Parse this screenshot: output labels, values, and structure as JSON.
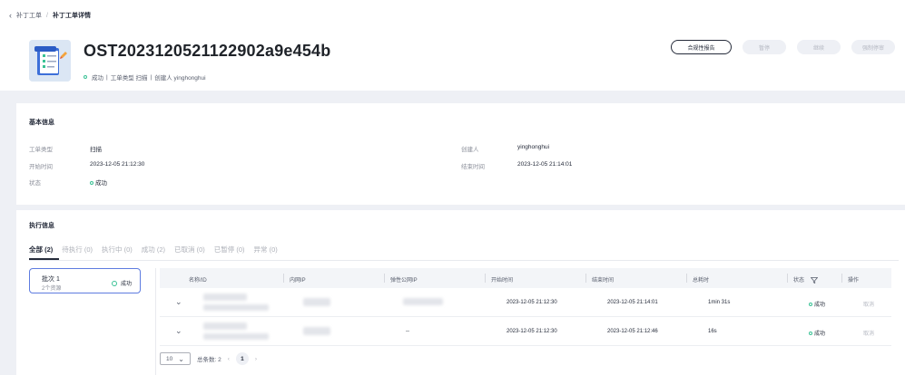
{
  "breadcrumb": {
    "back_icon": "‹",
    "parent": "补丁工单",
    "sep": "/",
    "current": "补丁工单详情"
  },
  "header": {
    "title": "OST2023120521122902a9e454b",
    "meta": {
      "status": "成功",
      "sep1": "|",
      "type": "工单类型 扫描",
      "sep2": "|",
      "creator": "创建人 yinghonghui"
    },
    "actions": {
      "compliance_report": "合规性报告",
      "pause": "暂停",
      "resume": "继续",
      "force_stop": "强制停审"
    }
  },
  "basic_info": {
    "title": "基本信息",
    "type_label": "工单类型",
    "type_value": "扫描",
    "start_label": "开始时间",
    "start_value": "2023-12-05 21:12:30",
    "status_label": "状态",
    "status_value": "成功",
    "creator_label": "创建人",
    "creator_value": "yinghonghui",
    "end_label": "结束时间",
    "end_value": "2023-12-05 21:14:01"
  },
  "exec_info": {
    "title": "执行信息",
    "tabs": [
      "全部 (2)",
      "待执行 (0)",
      "执行中 (0)",
      "成功 (2)",
      "已取消 (0)",
      "已暂停 (0)",
      "异常 (0)"
    ],
    "batch": {
      "name": "批次 1",
      "sub": "2个资源",
      "status": "成功"
    },
    "columns": [
      "名称/ID",
      "内网IP",
      "弹性公网IP",
      "开始时间",
      "结束时间",
      "总耗时",
      "状态",
      "操作"
    ],
    "rows": [
      {
        "eip": "",
        "start": "2023-12-05 21:12:30",
        "end": "2023-12-05 21:14:01",
        "duration": "1min 31s",
        "status": "成功",
        "action": "取消"
      },
      {
        "eip": "--",
        "start": "2023-12-05 21:12:30",
        "end": "2023-12-05 21:12:46",
        "duration": "16s",
        "status": "成功",
        "action": "取消"
      }
    ],
    "pager": {
      "size": "10",
      "total": "总条数: 2",
      "prev": "‹",
      "page": "1",
      "next": "›"
    }
  },
  "colors": {
    "accent": "#5e7ce0",
    "success": "#3ac295",
    "text": "#252b3a"
  }
}
